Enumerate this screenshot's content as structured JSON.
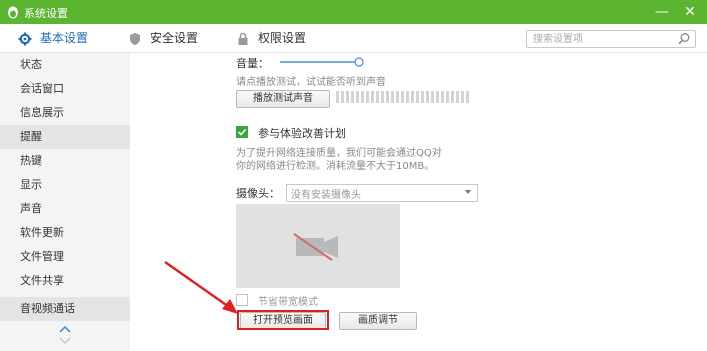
{
  "window": {
    "title": "系统设置",
    "minimize_glyph": "—",
    "close_glyph": "✕",
    "titlebar_color": "#5cb531"
  },
  "tabs": [
    {
      "label": "基本设置",
      "icon": "gear-icon",
      "active": true
    },
    {
      "label": "安全设置",
      "icon": "shield-icon",
      "active": false
    },
    {
      "label": "权限设置",
      "icon": "lock-icon",
      "active": false
    }
  ],
  "search": {
    "placeholder": "搜索设置项",
    "icon": "search-icon"
  },
  "sidebar": {
    "items": [
      {
        "label": "状态"
      },
      {
        "label": "会话窗口"
      },
      {
        "label": "信息展示"
      },
      {
        "label": "提醒"
      },
      {
        "label": "热键"
      },
      {
        "label": "显示"
      },
      {
        "label": "声音"
      },
      {
        "label": "软件更新"
      },
      {
        "label": "文件管理"
      },
      {
        "label": "文件共享"
      },
      {
        "label": "音视频通话"
      }
    ],
    "selected_items": [
      "提醒",
      "音视频通话"
    ]
  },
  "audio": {
    "volume_label": "音量：",
    "hint": "请点播放测试，试试能否听到声音",
    "play_test_button": "播放测试声音"
  },
  "improvement": {
    "checkbox_label": "参与体验改善计划",
    "checked": true,
    "desc_line1": "为了提升网络连接质量，我们可能会通过QQ对",
    "desc_line2": "你的网络进行检测。消耗流量不大于10MB。"
  },
  "camera": {
    "label": "摄像头：",
    "selected": "没有安装摄像头",
    "preview_icon": "camera-off-icon",
    "bandwidth_saving_label": "节省带宽模式",
    "bandwidth_saving_checked": false,
    "open_preview_button": "打开预览画面",
    "quality_button": "画质调节"
  },
  "annotation_color": "#e02020",
  "accent_color": "#1e6db8"
}
